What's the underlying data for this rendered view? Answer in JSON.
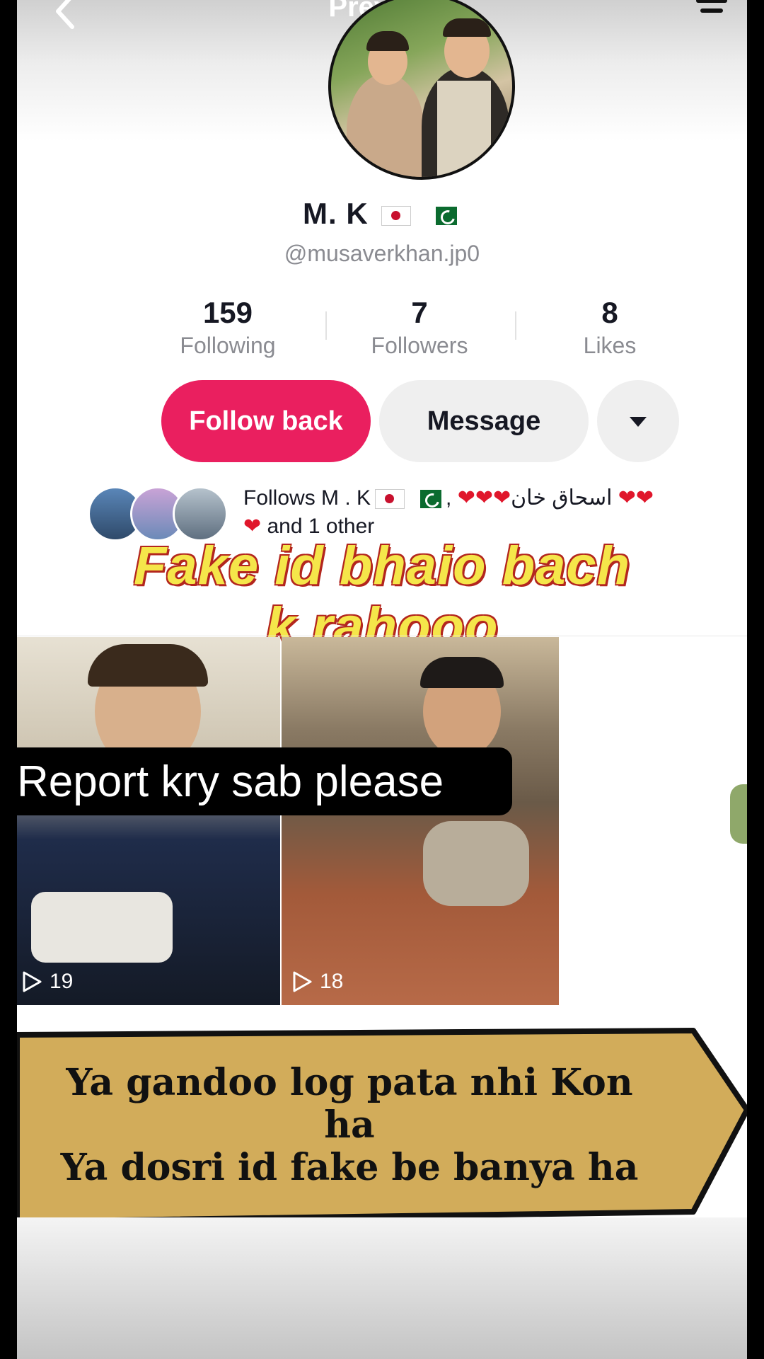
{
  "header": {
    "title": "Preview"
  },
  "profile": {
    "display_name": "M. K",
    "username": "@musaverkhan.jp0"
  },
  "stats": [
    {
      "value": "159",
      "label": "Following"
    },
    {
      "value": "7",
      "label": "Followers"
    },
    {
      "value": "8",
      "label": "Likes"
    }
  ],
  "actions": {
    "follow_back": "Follow back",
    "message": "Message"
  },
  "mutuals": {
    "line1_prefix": "Follows M . K",
    "line1_comma": ",",
    "line1_name": "اسحاق خان",
    "line2_suffix": "and 1 other"
  },
  "overlays": {
    "fake_line1": "Fake id  bhaio bach",
    "fake_line2": "k rahooo",
    "report": "Report kry sab please",
    "banner_line1": "Ya gandoo log pata nhi Kon",
    "banner_line2": "ha",
    "banner_line3": "Ya dosri id fake  be banya ha"
  },
  "videos": [
    {
      "views": "19"
    },
    {
      "views": "18"
    }
  ],
  "colors": {
    "accent": "#ea1f5f",
    "overlay_yellow": "#f5e64a",
    "banner_gold": "#d2ac5a"
  }
}
